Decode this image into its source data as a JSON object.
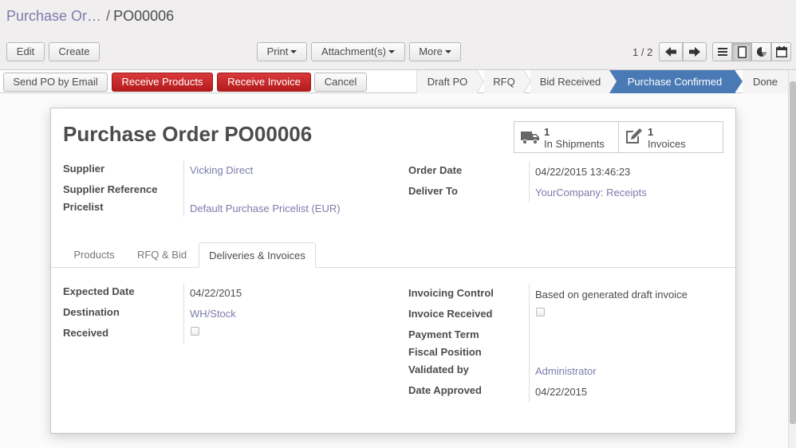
{
  "breadcrumb": {
    "parent": "Purchase Or…",
    "separator": "/",
    "current": "PO00006"
  },
  "toolbar": {
    "edit": "Edit",
    "create": "Create",
    "print": "Print",
    "attachments": "Attachment(s)",
    "more": "More"
  },
  "pager": {
    "value": "1 / 2"
  },
  "view_switcher": [
    "list-view-icon",
    "form-view-icon",
    "graph-view-icon",
    "calendar-view-icon"
  ],
  "actions": {
    "send_po": "Send PO by Email",
    "receive_products": "Receive Products",
    "receive_invoice": "Receive Invoice",
    "cancel": "Cancel"
  },
  "stages": [
    {
      "label": "Draft PO",
      "active": false
    },
    {
      "label": "RFQ",
      "active": false
    },
    {
      "label": "Bid Received",
      "active": false
    },
    {
      "label": "Purchase Confirmed",
      "active": true
    },
    {
      "label": "Done",
      "active": false
    }
  ],
  "form": {
    "title_prefix": "Purchase Order",
    "title_ref": "PO00006",
    "smart_buttons": [
      {
        "count": "1",
        "label": "In Shipments",
        "icon": "truck-icon"
      },
      {
        "count": "1",
        "label": "Invoices",
        "icon": "edit-icon"
      }
    ],
    "left_fields": [
      {
        "label": "Supplier",
        "value": "Vicking Direct"
      },
      {
        "label": "Supplier Reference",
        "value": ""
      },
      {
        "label": "Pricelist",
        "value": "Default Purchase Pricelist (EUR)"
      }
    ],
    "right_fields": [
      {
        "label": "Order Date",
        "value": "04/22/2015 13:46:23"
      },
      {
        "label": "Deliver To",
        "value": "YourCompany: Receipts"
      }
    ],
    "tabs": [
      "Products",
      "RFQ & Bid",
      "Deliveries & Invoices"
    ],
    "active_tab": "Deliveries & Invoices",
    "tab_left_fields": [
      {
        "label": "Expected Date",
        "value": "04/22/2015"
      },
      {
        "label": "Destination",
        "value": "WH/Stock"
      },
      {
        "label": "Received",
        "value": false
      }
    ],
    "tab_right_fields": [
      {
        "label": "Invoicing Control",
        "value": "Based on generated draft invoice"
      },
      {
        "label": "Invoice Received",
        "value": false
      },
      {
        "label": "Payment Term",
        "value": ""
      },
      {
        "label": "Fiscal Position",
        "value": ""
      },
      {
        "label": "Validated by",
        "value": "Administrator"
      },
      {
        "label": "Date Approved",
        "value": "04/22/2015"
      }
    ]
  },
  "colors": {
    "link": "#7c7bad",
    "primary_red": "#c0282a",
    "active_stage": "#4a7ab5"
  }
}
